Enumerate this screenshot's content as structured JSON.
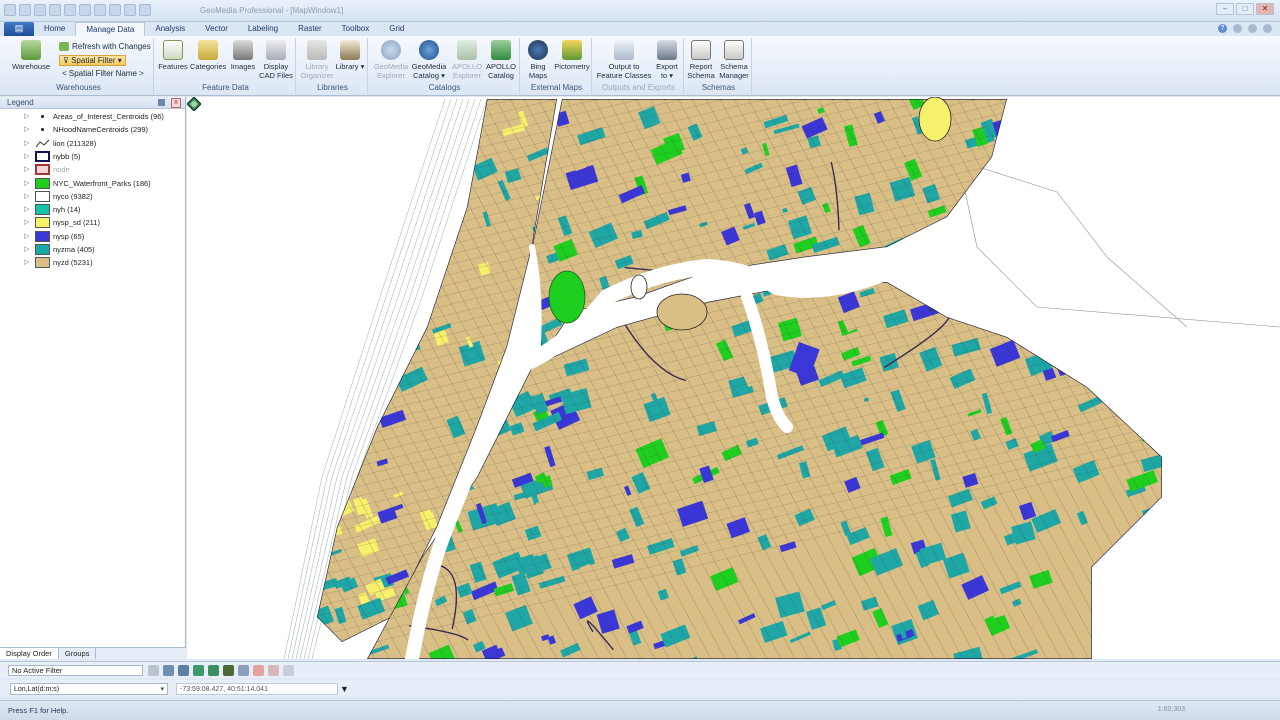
{
  "window": {
    "title": "GeoMedia Professional - [MapWindow1]",
    "controls": [
      "–",
      "□",
      "✕"
    ]
  },
  "ribbon": {
    "file_label": "▤",
    "tabs": [
      {
        "label": "Home"
      },
      {
        "label": "Manage Data"
      },
      {
        "label": "Analysis"
      },
      {
        "label": "Vector"
      },
      {
        "label": "Labeling"
      },
      {
        "label": "Raster"
      },
      {
        "label": "Toolbox"
      },
      {
        "label": "Grid"
      }
    ],
    "active_tab": "Manage Data",
    "groups": {
      "warehouses": {
        "label": "Warehouses",
        "warehouse": "Warehouse",
        "refresh": "Refresh with Changes",
        "spatial_filter": "Spatial Filter",
        "spatial_filter_name": "< Spatial Filter Name >"
      },
      "feature_data": {
        "label": "Feature Data",
        "features": "Features",
        "categories": "Categories",
        "images": "Images",
        "display_cad_1": "Display",
        "display_cad_2": "CAD Files"
      },
      "libraries": {
        "label": "Libraries",
        "library_organizer_1": "Library",
        "library_organizer_2": "Organizer",
        "library": "Library"
      },
      "catalogs": {
        "label": "Catalogs",
        "gm_explorer_1": "GeoMedia",
        "gm_explorer_2": "Explorer",
        "gm_catalog_1": "GeoMedia",
        "gm_catalog_2": "Catalog",
        "apollo_explorer_1": "APOLLO",
        "apollo_explorer_2": "Explorer",
        "apollo_catalog_1": "APOLLO",
        "apollo_catalog_2": "Catalog"
      },
      "external_maps": {
        "label": "External Maps",
        "bing_1": "Bing",
        "bing_2": "Maps",
        "pictometry": "Pictometry"
      },
      "outputs": {
        "label": "Outputs and Exports",
        "output_1": "Output to",
        "output_2": "Feature Classes",
        "export_1": "Export",
        "export_2": "to"
      },
      "schemas": {
        "label": "Schemas",
        "report_1": "Report",
        "report_2": "Schema",
        "schema_1": "Schema",
        "schema_2": "Manager"
      }
    }
  },
  "legend": {
    "title": "Legend",
    "close": "x",
    "entries": [
      {
        "name": "Areas_of_Interest_Centroids (96)",
        "symbol": "point",
        "color": "#111111"
      },
      {
        "name": "NHoodNameCentroids (299)",
        "symbol": "point",
        "color": "#111111"
      },
      {
        "name": "lion (211328)",
        "symbol": "line",
        "color": "#333333"
      },
      {
        "name": "nybb (5)",
        "symbol": "area",
        "color": "#ffffff",
        "border": "#111155"
      },
      {
        "name": "node",
        "symbol": "area",
        "color": "#f3d6d6",
        "border": "#aa3333",
        "disabled": true
      },
      {
        "name": "NYC_Waterfront_Parks (186)",
        "symbol": "area",
        "color": "#1fcf1f"
      },
      {
        "name": "nyco (9382)",
        "symbol": "area",
        "color": "#ffffff"
      },
      {
        "name": "nyh (14)",
        "symbol": "area",
        "color": "#14c4a8"
      },
      {
        "name": "nysp_sd (211)",
        "symbol": "area",
        "color": "#f6f06a"
      },
      {
        "name": "nysp (65)",
        "symbol": "area",
        "color": "#3a36d8"
      },
      {
        "name": "nyzma (405)",
        "symbol": "area",
        "color": "#1aa8a8"
      },
      {
        "name": "nyzd (5231)",
        "symbol": "area",
        "color": "#d9bf86"
      }
    ],
    "tabs": [
      "Display Order",
      "Groups"
    ]
  },
  "map_colors": {
    "land": "#d9bf86",
    "teal": "#1fa7a6",
    "park": "#1fcf1f",
    "special": "#3a36d8",
    "yellow": "#f6f06a",
    "street": "#3b2a55",
    "water": "#ffffff"
  },
  "filter_bar": {
    "active_filter": "No Active Filter"
  },
  "coordinate_bar": {
    "system": "Lon,Lat(d:m:s)",
    "value": "-73:59:08.427, 40:51:14.041",
    "menu": "▼"
  },
  "status": {
    "text": "Press F1 for Help.",
    "scale": "1:60,303"
  }
}
